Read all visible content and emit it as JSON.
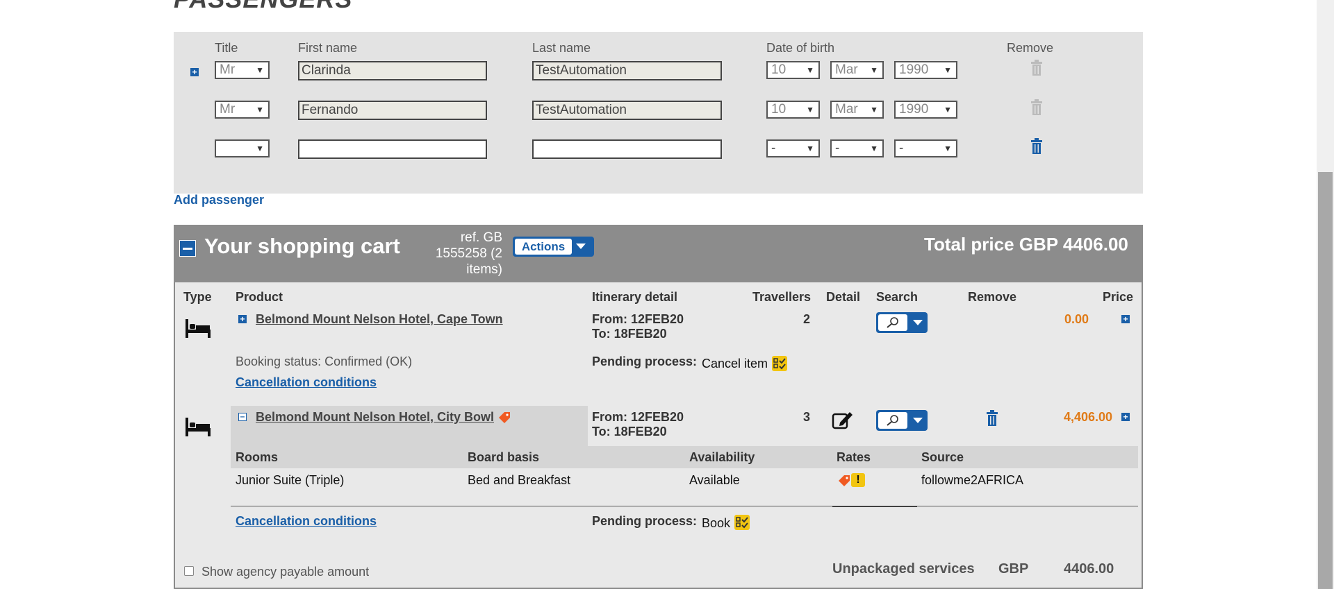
{
  "passengers": {
    "heading": "PASSENGERS",
    "columns": {
      "title": "Title",
      "first_name": "First name",
      "last_name": "Last name",
      "dob": "Date of birth",
      "remove": "Remove"
    },
    "rows": [
      {
        "title": "Mr",
        "first": "Clarinda",
        "last": "TestAutomation",
        "day": "10",
        "month": "Mar",
        "year": "1990"
      },
      {
        "title": "Mr",
        "first": "Fernando",
        "last": "TestAutomation",
        "day": "10",
        "month": "Mar",
        "year": "1990"
      },
      {
        "title": "",
        "first": "",
        "last": "",
        "day": "-",
        "month": "-",
        "year": "-"
      }
    ],
    "add_label": "Add passenger"
  },
  "cart": {
    "title": "Your shopping cart",
    "ref_line1": "ref. GB",
    "ref_line2": "1555258 (2",
    "ref_line3": "items)",
    "actions_label": "Actions",
    "total_label": "Total price",
    "total_currency": "GBP",
    "total_value": "4406.00",
    "headers": {
      "type": "Type",
      "product": "Product",
      "itinerary": "Itinerary detail",
      "travellers": "Travellers",
      "detail": "Detail",
      "search": "Search",
      "remove": "Remove",
      "price": "Price"
    },
    "items": [
      {
        "name": "Belmond Mount Nelson Hotel, Cape Town",
        "from": "From: 12FEB20",
        "to": "To: 18FEB20",
        "travellers": "2",
        "price": "0.00",
        "status": "Booking status: Confirmed (OK)",
        "cancel": "Cancellation conditions",
        "pending_label": "Pending process:",
        "pending_value": "Cancel item"
      },
      {
        "name": "Belmond Mount Nelson Hotel, City Bowl",
        "from": "From: 12FEB20",
        "to": "To: 18FEB20",
        "travellers": "3",
        "price": "4,406.00",
        "rooms_headers": {
          "rooms": "Rooms",
          "board": "Board basis",
          "availability": "Availability",
          "rates": "Rates",
          "source": "Source"
        },
        "room": {
          "rooms": "Junior Suite (Triple)",
          "board": "Bed and Breakfast",
          "availability": "Available",
          "source": "followme2AFRICA"
        },
        "cancel": "Cancellation conditions",
        "pending_label": "Pending process:",
        "pending_value": "Book"
      }
    ],
    "agency_label": "Show agency payable amount",
    "summary": {
      "label": "Unpackaged services",
      "currency": "GBP",
      "value": "4406.00"
    }
  },
  "colors": {
    "accent": "#1a5fa8",
    "cart_header": "#8c8c8c",
    "price_orange": "#e07b18",
    "pending_yellow": "#f2c511"
  }
}
